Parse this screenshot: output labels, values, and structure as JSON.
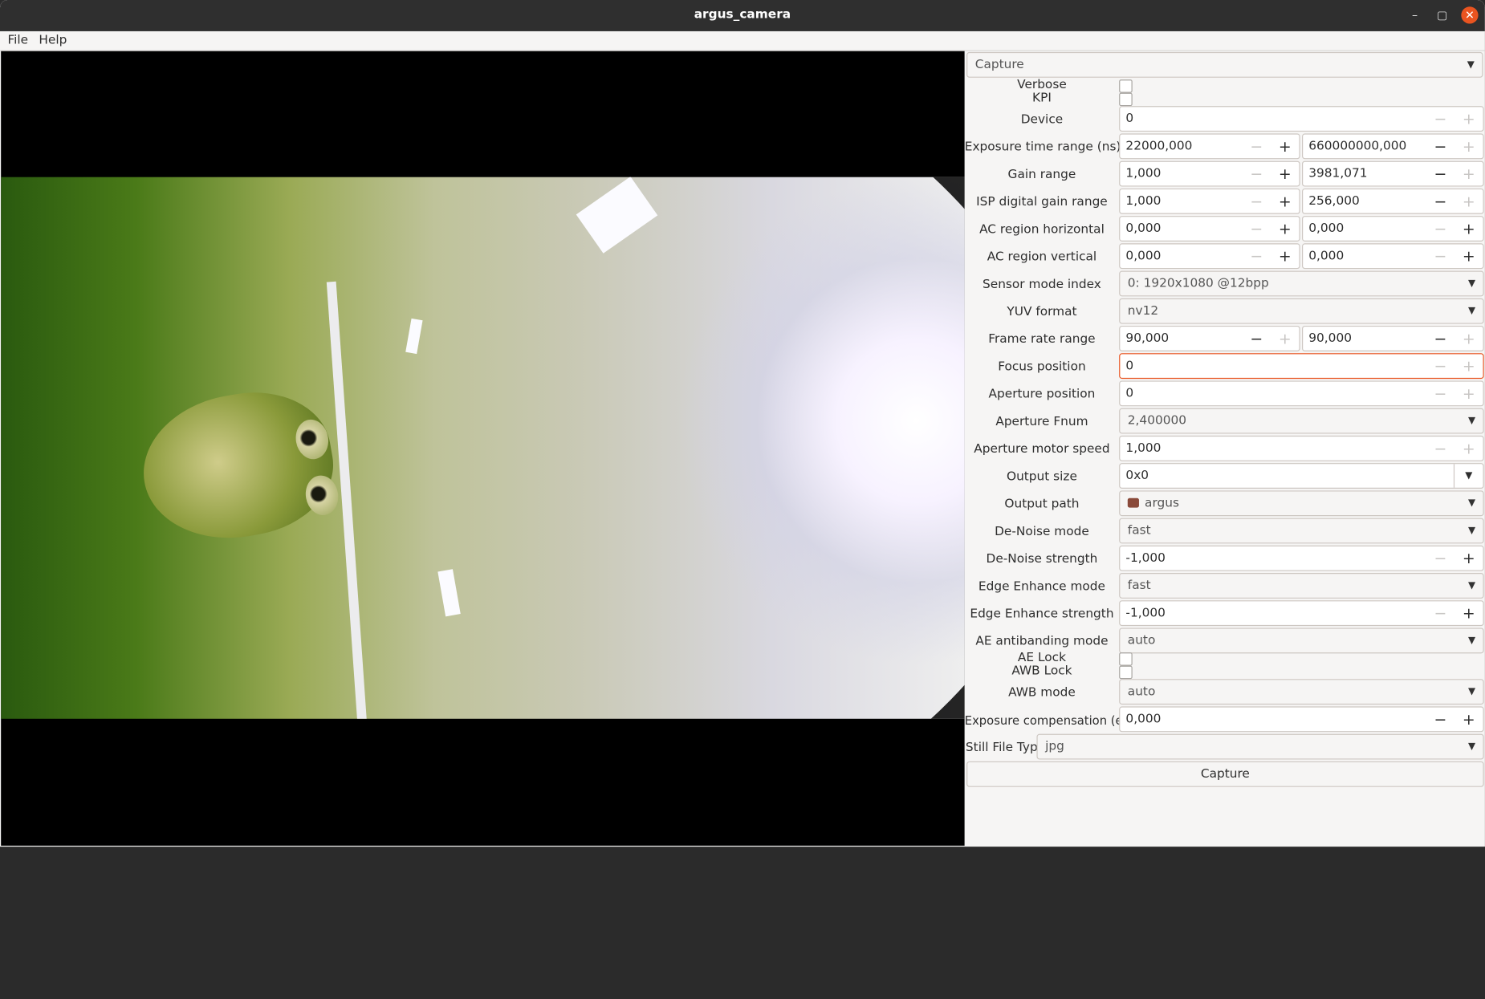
{
  "window": {
    "title": "argus_camera"
  },
  "menubar": {
    "file": "File",
    "help": "Help"
  },
  "panel": {
    "mode_combo": "Capture",
    "verbose_label": "Verbose",
    "kpi_label": "KPI",
    "device": {
      "label": "Device",
      "value": "0"
    },
    "exposure": {
      "label": "Exposure time range (ns)",
      "min": "22000,000",
      "max": "660000000,000"
    },
    "gain": {
      "label": "Gain range",
      "min": "1,000",
      "max": "3981,071"
    },
    "isp_gain": {
      "label": "ISP digital gain range",
      "min": "1,000",
      "max": "256,000"
    },
    "ac_h": {
      "label": "AC region horizontal",
      "min": "0,000",
      "max": "0,000"
    },
    "ac_v": {
      "label": "AC region vertical",
      "min": "0,000",
      "max": "0,000"
    },
    "sensor_mode": {
      "label": "Sensor mode index",
      "value": "0: 1920x1080 @12bpp"
    },
    "yuv": {
      "label": "YUV format",
      "value": "nv12"
    },
    "frame_rate": {
      "label": "Frame rate range",
      "min": "90,000",
      "max": "90,000"
    },
    "focus": {
      "label": "Focus position",
      "value": "0"
    },
    "aperture_pos": {
      "label": "Aperture position",
      "value": "0"
    },
    "aperture_fnum": {
      "label": "Aperture Fnum",
      "value": "2,400000"
    },
    "aperture_speed": {
      "label": "Aperture motor speed",
      "value": "1,000"
    },
    "output_size": {
      "label": "Output size",
      "value": "0x0"
    },
    "output_path": {
      "label": "Output path",
      "value": "argus"
    },
    "denoise_mode": {
      "label": "De-Noise mode",
      "value": "fast"
    },
    "denoise_strength": {
      "label": "De-Noise strength",
      "value": "-1,000"
    },
    "edge_mode": {
      "label": "Edge Enhance mode",
      "value": "fast"
    },
    "edge_strength": {
      "label": "Edge Enhance strength",
      "value": "-1,000"
    },
    "ae_antibanding": {
      "label": "AE antibanding mode",
      "value": "auto"
    },
    "ae_lock_label": "AE Lock",
    "awb_lock_label": "AWB Lock",
    "awb_mode": {
      "label": "AWB mode",
      "value": "auto"
    },
    "exp_comp": {
      "label": "Exposure compensation (ev)",
      "value": "0,000"
    },
    "still_type": {
      "label": "Still File Type",
      "value": "jpg"
    },
    "capture_button": "Capture"
  },
  "icons": {
    "minus": "−",
    "plus": "+",
    "dropdown": "▼",
    "minimize": "–",
    "maximize": "▢",
    "close": "✕"
  }
}
